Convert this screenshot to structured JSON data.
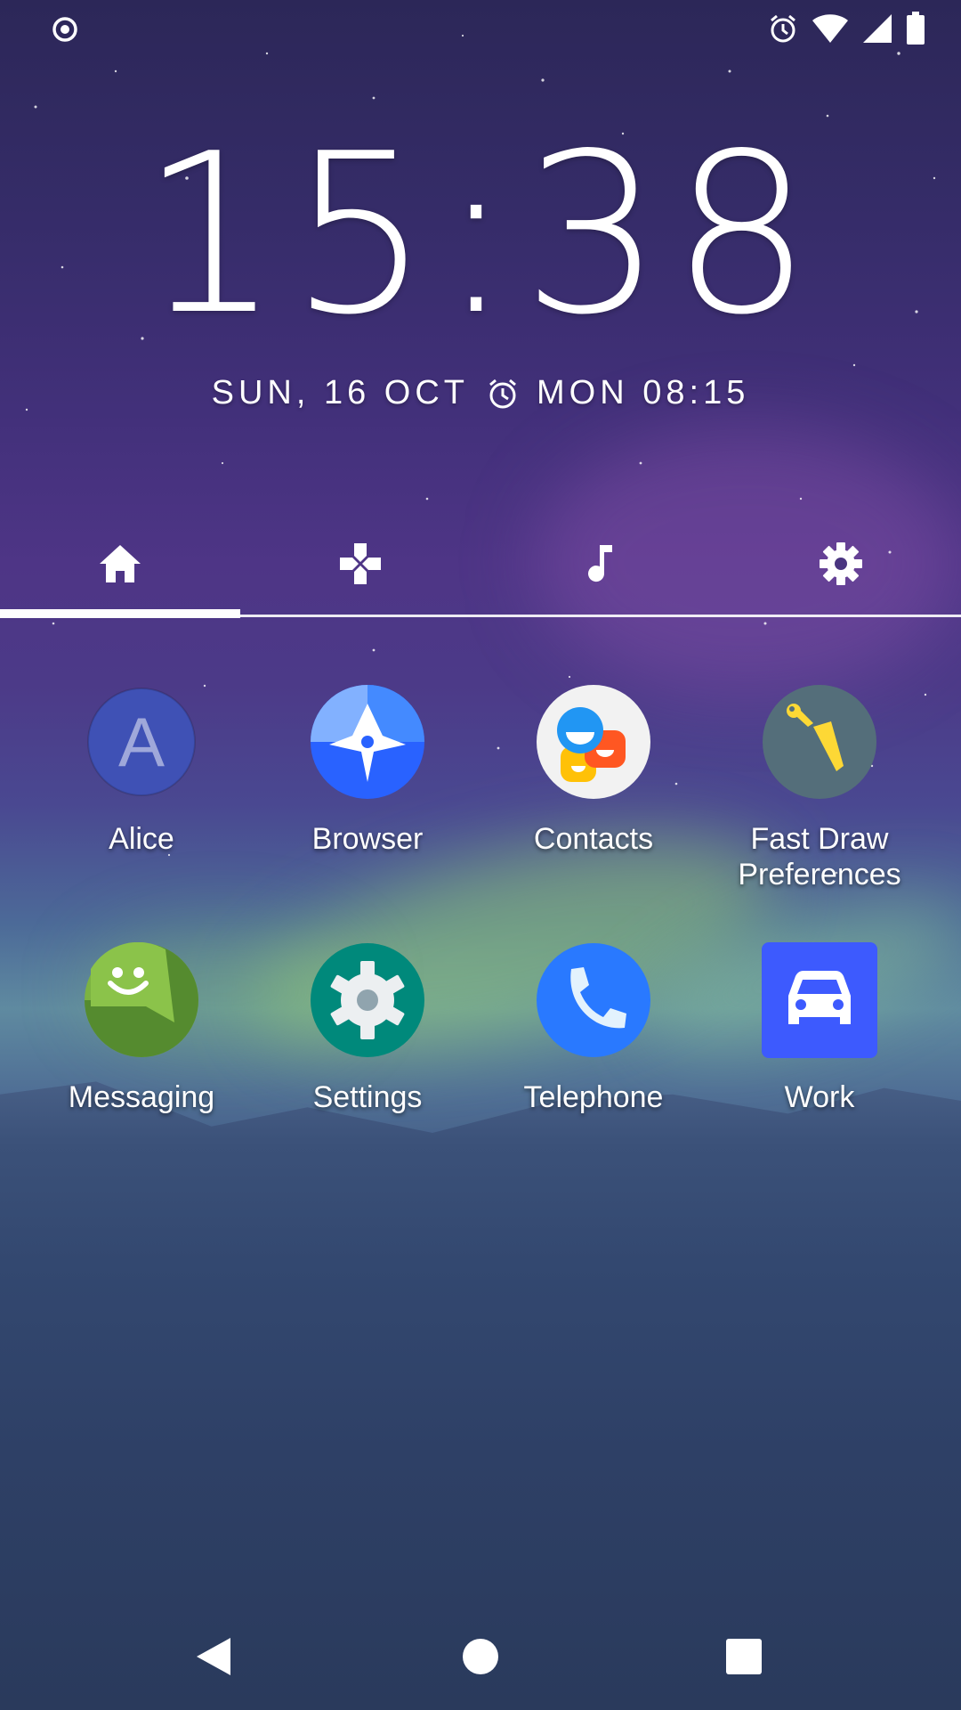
{
  "status_bar": {
    "left_icon": "record-icon",
    "right_icons": [
      "alarm-icon",
      "wifi-icon",
      "signal-icon",
      "battery-icon"
    ]
  },
  "lockclock": {
    "time": "15:38",
    "date": "SUN, 16 OCT",
    "alarm": "MON 08:15"
  },
  "tabs": [
    {
      "icon": "home-icon",
      "selected": true
    },
    {
      "icon": "gamepad-icon",
      "selected": false
    },
    {
      "icon": "music-note-icon",
      "selected": false
    },
    {
      "icon": "gear-icon",
      "selected": false
    }
  ],
  "apps": [
    {
      "label": "Alice",
      "icon": "alice-avatar-icon",
      "letter": "A"
    },
    {
      "label": "Browser",
      "icon": "browser-icon"
    },
    {
      "label": "Contacts",
      "icon": "contacts-icon"
    },
    {
      "label": "Fast Draw Preferences",
      "label_line1": "Fast Draw",
      "label_line2": "Preferences",
      "icon": "fast-draw-icon"
    },
    {
      "label": "Messaging",
      "icon": "messaging-icon"
    },
    {
      "label": "Settings",
      "icon": "settings-icon"
    },
    {
      "label": "Telephone",
      "icon": "telephone-icon"
    },
    {
      "label": "Work",
      "icon": "car-icon"
    }
  ],
  "navbar": {
    "buttons": [
      "back-icon",
      "home-circle-icon",
      "recents-icon"
    ]
  },
  "colors": {
    "alice_bg": "#3f51b5",
    "browser_bg": "#2962ff",
    "contacts_bg": "#f2f2f2",
    "fast_draw_bg": "#546e7a",
    "messaging_bg": "#7cb342",
    "settings_bg": "#00897b",
    "telephone_bg": "#2979ff",
    "work_bg": "#3d5afe"
  }
}
